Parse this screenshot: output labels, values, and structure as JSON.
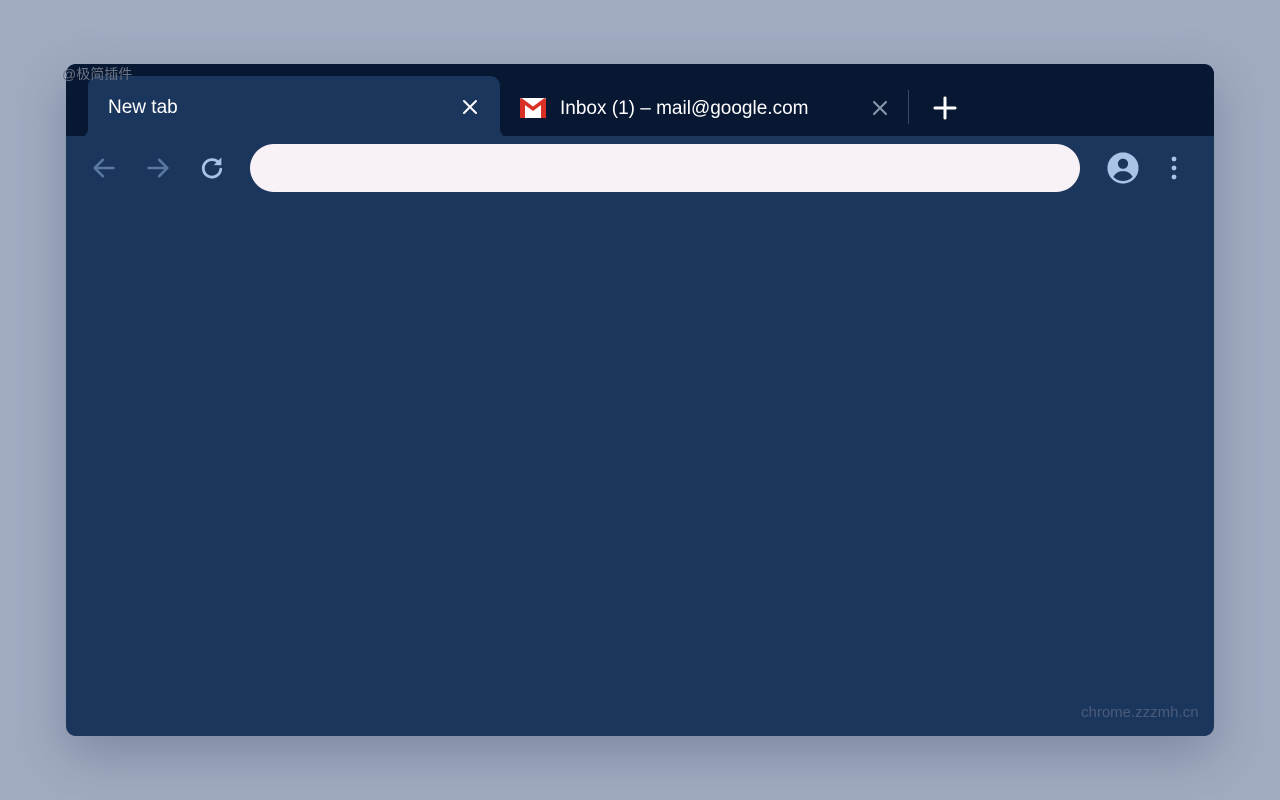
{
  "watermarks": {
    "top_left": "@极简插件",
    "bottom_right": "chrome.zzzmh.cn"
  },
  "tabs": [
    {
      "title": "New tab",
      "active": true
    },
    {
      "title": "Inbox (1) – mail@google.com",
      "active": false,
      "favicon": "gmail-icon"
    }
  ],
  "omnibox": {
    "value": "",
    "placeholder": ""
  },
  "icons": {
    "back": "arrow-left-icon",
    "forward": "arrow-right-icon",
    "reload": "reload-icon",
    "profile": "account-circle-icon",
    "menu": "more-vertical-icon",
    "new_tab": "plus-icon",
    "close": "close-icon"
  },
  "colors": {
    "page_background": "#a1abc1",
    "tabstrip": "#081833",
    "toolbar": "#1b365d",
    "omnibox": "#f8f1f6",
    "icon": "#a8c3e6",
    "icon_disabled": "#5a78a1"
  }
}
